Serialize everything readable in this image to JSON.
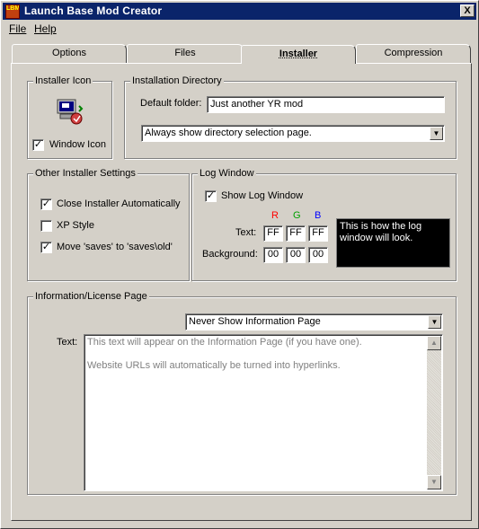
{
  "window": {
    "title": "Launch Base Mod Creator",
    "close_label": "X",
    "icon_text": "LBMC"
  },
  "menu": {
    "file": "File",
    "help": "Help"
  },
  "tabs": [
    {
      "label": "Options"
    },
    {
      "label": "Files"
    },
    {
      "label": "Installer"
    },
    {
      "label": "Compression"
    }
  ],
  "installer_icon": {
    "group_title": "Installer Icon",
    "checkbox_label": "Window Icon",
    "checked": true
  },
  "installation_directory": {
    "group_title": "Installation Directory",
    "default_folder_label": "Default folder:",
    "default_folder_value": "Just another YR mod",
    "mode_selected": "Always show directory selection page."
  },
  "other_settings": {
    "group_title": "Other Installer Settings",
    "items": [
      {
        "label": "Close Installer Automatically",
        "checked": true
      },
      {
        "label": "XP Style",
        "checked": false
      },
      {
        "label": "Move 'saves' to 'saves\\old'",
        "checked": true
      }
    ]
  },
  "log_window": {
    "group_title": "Log Window",
    "show_label": "Show Log Window",
    "show_checked": true,
    "r_label": "R",
    "g_label": "G",
    "b_label": "B",
    "r_color": "#ff0000",
    "g_color": "#00a000",
    "b_color": "#0000ff",
    "text_label": "Text:",
    "text_r": "FF",
    "text_g": "FF",
    "text_b": "FF",
    "background_label": "Background:",
    "bg_r": "00",
    "bg_g": "00",
    "bg_b": "00",
    "preview_line1": "This is how the log",
    "preview_line2": "window will look."
  },
  "info_page": {
    "group_title": "Information/License Page",
    "mode_selected": "Never Show Information Page",
    "text_label": "Text:",
    "text_line1": "This text will appear on the Information Page (if you have one).",
    "text_line2": "Website URLs will automatically be turned into hyperlinks."
  }
}
